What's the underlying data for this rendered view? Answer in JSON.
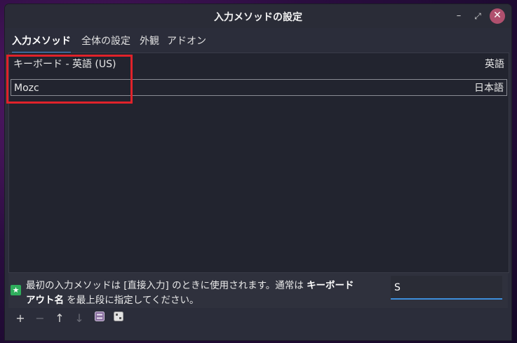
{
  "window": {
    "title": "入力メソッドの設定"
  },
  "tabs": [
    {
      "label": "入力メソッド"
    },
    {
      "label": "全体の設定"
    },
    {
      "label": "外観"
    },
    {
      "label": "アドオン"
    }
  ],
  "input_methods": [
    {
      "name": "キーボード - 英語 (US)",
      "language": "英語"
    },
    {
      "name": "Mozc",
      "language": "日本語"
    }
  ],
  "info": {
    "text_part1": "最初の入力メソッドは [直接入力] のときに使用されます。通常は ",
    "text_bold1": "キーボード",
    "text_bold2": "アウト名",
    "text_part2": " を最上段に指定してください。"
  },
  "search": {
    "value": "S"
  },
  "icons": {
    "info": "star-icon",
    "add": "plus-icon",
    "remove": "minus-icon",
    "up": "arrow-up-icon",
    "down": "arrow-down-icon",
    "configure": "configure-icon",
    "keyboard": "keyboard-layout-icon"
  },
  "colors": {
    "accent": "#3d8edb",
    "highlight_box": "#e0222a",
    "close_button": "#b0506e"
  }
}
